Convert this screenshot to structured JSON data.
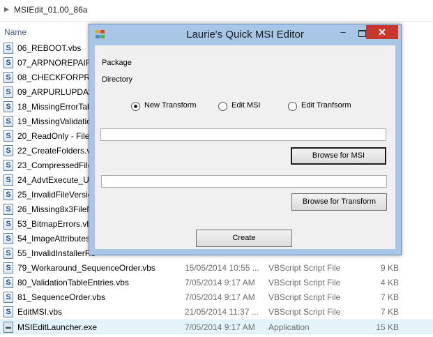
{
  "explorer": {
    "breadcrumb": "MSIEdit_01.00_86a",
    "column_name": "Name",
    "files": [
      {
        "name": "06_REBOOT.vbs",
        "date": "",
        "type": "",
        "size": "",
        "icon": "vbs-script-icon"
      },
      {
        "name": "07_ARPNOREPAIR.v",
        "date": "",
        "type": "",
        "size": "",
        "icon": "vbs-script-icon"
      },
      {
        "name": "08_CHECKFORPRO",
        "date": "",
        "type": "",
        "size": "",
        "icon": "vbs-script-icon"
      },
      {
        "name": "09_ARPURLUPDATI",
        "date": "",
        "type": "",
        "size": "",
        "icon": "vbs-script-icon"
      },
      {
        "name": "18_MissingErrorTab",
        "date": "",
        "type": "",
        "size": "",
        "icon": "vbs-script-icon"
      },
      {
        "name": "19_MissingValidatio",
        "date": "",
        "type": "",
        "size": "",
        "icon": "vbs-script-icon"
      },
      {
        "name": "20_ReadOnly - File",
        "date": "",
        "type": "",
        "size": "",
        "icon": "vbs-script-icon"
      },
      {
        "name": "22_CreateFolders.vb",
        "date": "",
        "type": "",
        "size": "",
        "icon": "vbs-script-icon"
      },
      {
        "name": "23_CompressedFile",
        "date": "",
        "type": "",
        "size": "",
        "icon": "vbs-script-icon"
      },
      {
        "name": "24_AdvtExecute_Ur",
        "date": "",
        "type": "",
        "size": "",
        "icon": "vbs-script-icon"
      },
      {
        "name": "25_InvalidFileVersic",
        "date": "",
        "type": "",
        "size": "",
        "icon": "vbs-script-icon"
      },
      {
        "name": "26_Missing8x3FileN",
        "date": "",
        "type": "",
        "size": "",
        "icon": "vbs-script-icon"
      },
      {
        "name": "53_BitmapErrors.vb",
        "date": "",
        "type": "",
        "size": "",
        "icon": "vbs-script-icon"
      },
      {
        "name": "54_ImageAttributes",
        "date": "",
        "type": "",
        "size": "",
        "icon": "vbs-script-icon"
      },
      {
        "name": "55_InvalidInstallerRe",
        "date": "",
        "type": "",
        "size": "",
        "icon": "vbs-script-icon"
      },
      {
        "name": "79_Workaround_SequenceOrder.vbs",
        "date": "15/05/2014 10:55 ...",
        "type": "VBScript Script File",
        "size": "9 KB",
        "icon": "vbs-script-icon"
      },
      {
        "name": "80_ValidationTableEntries.vbs",
        "date": "7/05/2014 9:17 AM",
        "type": "VBScript Script File",
        "size": "4 KB",
        "icon": "vbs-script-icon"
      },
      {
        "name": "81_SequenceOrder.vbs",
        "date": "7/05/2014 9:17 AM",
        "type": "VBScript Script File",
        "size": "7 KB",
        "icon": "vbs-script-icon"
      },
      {
        "name": "EditMSI.vbs",
        "date": "21/05/2014 11:37 ...",
        "type": "VBScript Script File",
        "size": "7 KB",
        "icon": "vbs-script-icon"
      },
      {
        "name": "MSIEditLauncher.exe",
        "date": "7/05/2014 9:17 AM",
        "type": "Application",
        "size": "15 KB",
        "icon": "application-icon",
        "selected": true
      }
    ]
  },
  "dialog": {
    "title": "Laurie's Quick MSI Editor",
    "minimize": "–",
    "close": "✕",
    "package_label": "Package",
    "directory_label": "Directory",
    "radio_new_transform": "New Transform",
    "radio_edit_msi": "Edit MSI",
    "radio_edit_transform": "Edit Tranfsorm",
    "selected_option": "New Transform",
    "msi_path_value": "",
    "transform_path_value": "",
    "browse_msi": "Browse for MSI",
    "browse_transform": "Browse for Transform",
    "create": "Create"
  },
  "colors": {
    "titlebar": "#a8c7e7",
    "close_button": "#c7372b",
    "client": "#f0f0f0",
    "selected_row": "#e5f3fb"
  }
}
